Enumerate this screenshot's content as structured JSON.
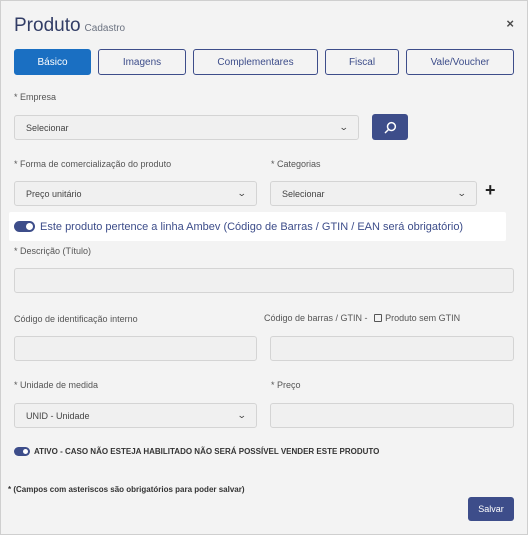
{
  "modal": {
    "title": "Produto",
    "subtitle": "Cadastro",
    "close_icon": "×"
  },
  "tabs": [
    {
      "label": "Básico",
      "active": true
    },
    {
      "label": "Imagens",
      "active": false
    },
    {
      "label": "Complementares",
      "active": false
    },
    {
      "label": "Fiscal",
      "active": false
    },
    {
      "label": "Vale/Voucher",
      "active": false
    }
  ],
  "form": {
    "empresa": {
      "label": "* Empresa",
      "value": "Selecionar"
    },
    "forma_comercializacao": {
      "label": "* Forma de comercialização do produto",
      "value": "Preço unitário"
    },
    "categorias": {
      "label": "* Categorias",
      "value": "Selecionar"
    },
    "ambev_toggle": {
      "label": "Este produto pertence a linha Ambev (Código de Barras / GTIN / EAN será obrigatório)",
      "on": true
    },
    "descricao": {
      "label": "* Descrição (Título)",
      "value": ""
    },
    "codigo_interno": {
      "label": "Código de identificação interno",
      "value": ""
    },
    "codigo_barras": {
      "label": "Código de barras / GTIN -",
      "checkbox_label": "Produto sem GTIN",
      "checked": false,
      "value": ""
    },
    "unidade": {
      "label": "* Unidade de medida",
      "value": "UNID - Unidade"
    },
    "preco": {
      "label": "* Preço",
      "value": ""
    },
    "ativo": {
      "label": "ATIVO - CASO NÃO ESTEJA HABILITADO NÃO SERÁ POSSÍVEL VENDER ESTE PRODUTO",
      "on": true
    }
  },
  "footer": {
    "note": "* (Campos com asteriscos são obrigatórios para poder salvar)",
    "save_label": "Salvar"
  },
  "icons": {
    "search": "search-icon",
    "plus": "+",
    "chevron": "⌄"
  },
  "colors": {
    "primary": "#3d4d8a",
    "active_tab": "#1a6fc2"
  }
}
